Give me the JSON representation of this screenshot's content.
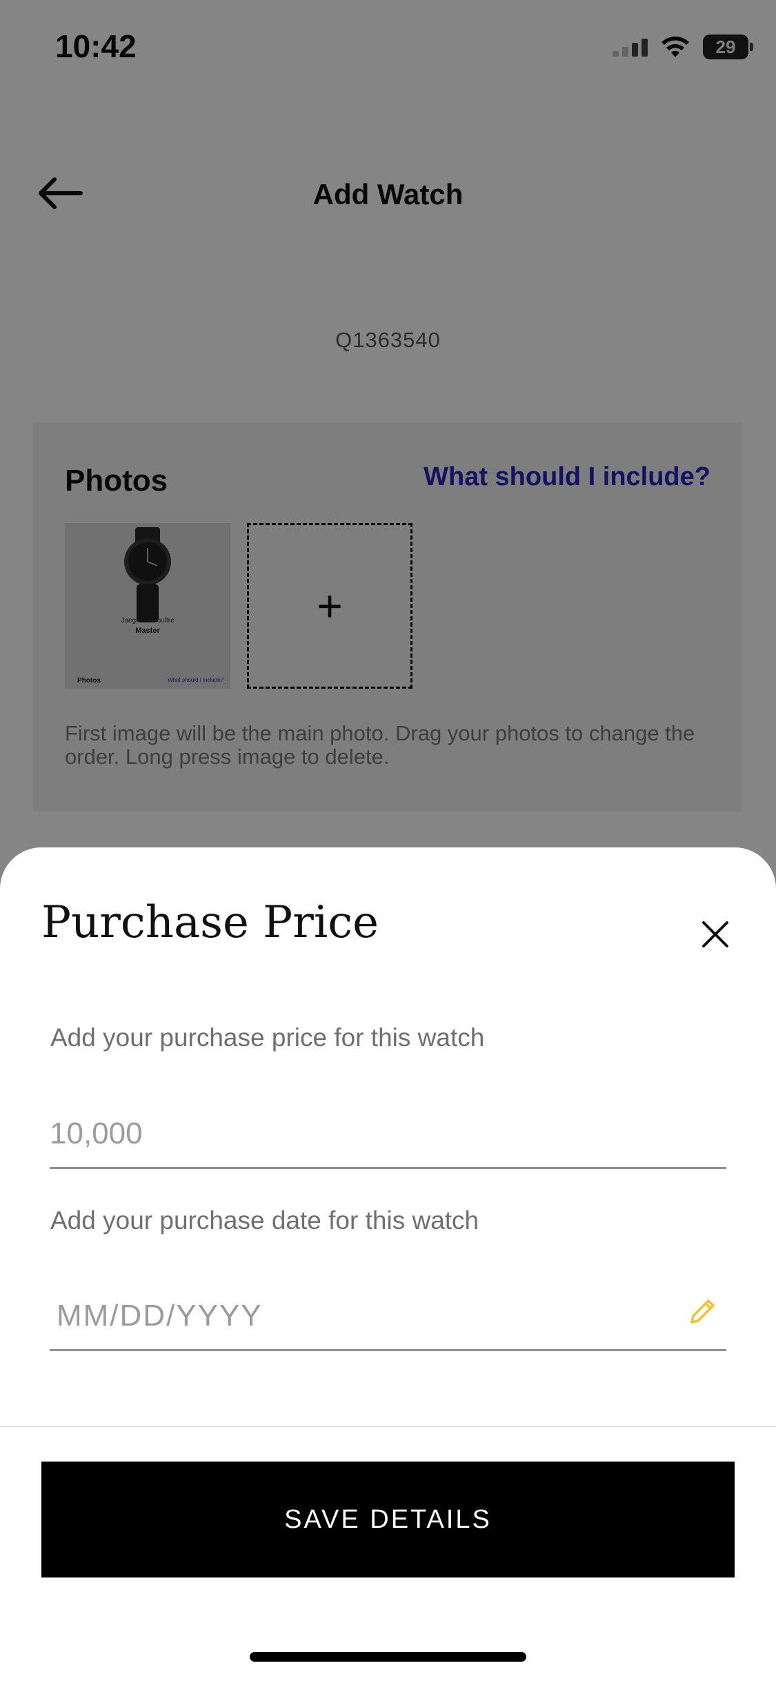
{
  "status_bar": {
    "time": "10:42",
    "battery": "29"
  },
  "header": {
    "title": "Add Watch"
  },
  "reference": "Q1363540",
  "photos": {
    "title": "Photos",
    "help_link": "What should I include?",
    "thumbnail": {
      "brand": "Jaeger-LeCoultre",
      "model": "Master",
      "photos_label": "Photos",
      "help_label": "What should I include?"
    },
    "add_symbol": "+",
    "hint": "First image will be the main photo. Drag your photos to change the order. Long press image to delete."
  },
  "sheet": {
    "title": "Purchase Price",
    "price_label": "Add your purchase price for this watch",
    "price_value": "",
    "price_placeholder": "10,000",
    "date_label": "Add your purchase date for this watch",
    "date_value": "",
    "date_placeholder": "MM/DD/YYYY",
    "save_label": "SAVE DETAILS"
  },
  "colors": {
    "accent_link": "#2a24b8",
    "edit_icon": "#f2c230",
    "primary_button": "#000000"
  },
  "icons": {
    "back": "arrow-left-icon",
    "close": "close-icon",
    "edit": "pencil-icon",
    "add": "plus-icon"
  }
}
